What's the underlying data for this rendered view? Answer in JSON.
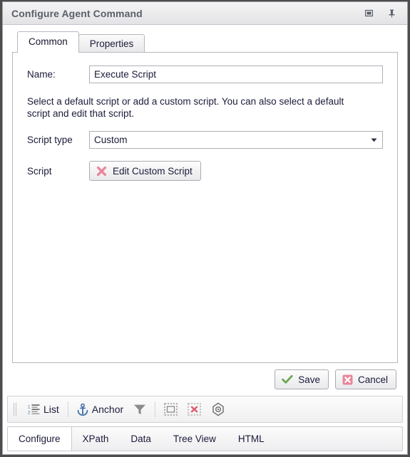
{
  "window": {
    "title": "Configure Agent Command",
    "buttons": [
      {
        "name": "restore-window-button",
        "icon": "restore-icon"
      },
      {
        "name": "pin-window-button",
        "icon": "pin-icon"
      }
    ]
  },
  "tabs": {
    "items": [
      {
        "label": "Common",
        "active": true
      },
      {
        "label": "Properties",
        "active": false
      }
    ]
  },
  "form": {
    "name_label": "Name:",
    "name_value": "Execute Script",
    "name_placeholder": "",
    "help_text": "Select a default script or add a custom script. You can also select a default script and edit that script.",
    "script_type_label": "Script type",
    "script_type_value": "Custom",
    "script_type_options": [
      "Custom"
    ],
    "script_label": "Script",
    "edit_script_button": "Edit Custom Script"
  },
  "footer": {
    "save_label": "Save",
    "cancel_label": "Cancel"
  },
  "toolbar": {
    "items": [
      {
        "label": "List",
        "icon": "numbered-list-icon",
        "name": "toolbar-list-button"
      },
      {
        "label": "Anchor",
        "icon": "anchor-icon",
        "name": "toolbar-anchor-button"
      },
      {
        "label": "",
        "icon": "filter-icon",
        "name": "toolbar-filter-button"
      },
      {
        "label": "",
        "icon": "select-element-icon",
        "name": "toolbar-select-element-button"
      },
      {
        "label": "",
        "icon": "remove-selection-icon",
        "name": "toolbar-remove-selection-button"
      },
      {
        "label": "",
        "icon": "target-icon",
        "name": "toolbar-target-button"
      }
    ]
  },
  "bottom_tabs": {
    "items": [
      {
        "label": "Configure",
        "active": true
      },
      {
        "label": "XPath",
        "active": false
      },
      {
        "label": "Data",
        "active": false
      },
      {
        "label": "Tree View",
        "active": false
      },
      {
        "label": "HTML",
        "active": false
      }
    ]
  },
  "colors": {
    "title_text": "#5b5f6b",
    "accent_green": "#6aa84f",
    "accent_red": "#e8879b",
    "accent_blue": "#3d6fa5",
    "frame": "#4d4d4d"
  }
}
